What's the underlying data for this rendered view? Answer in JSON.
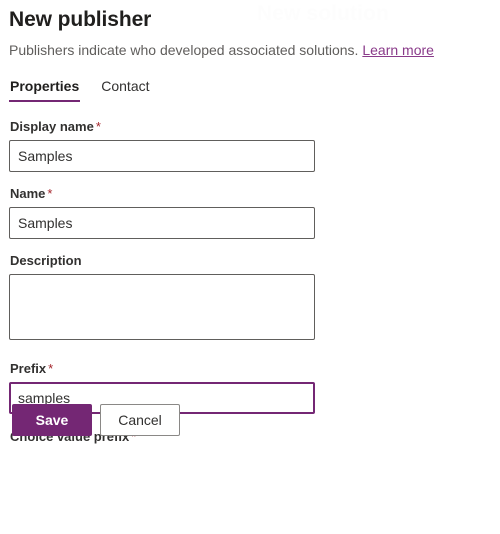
{
  "ghost": {
    "background_title": "New solution"
  },
  "header": {
    "title": "New publisher",
    "subtitle_text": "Publishers indicate who developed associated solutions.",
    "learn_more_label": "Learn more"
  },
  "tabs": [
    {
      "label": "Properties",
      "active": true
    },
    {
      "label": "Contact",
      "active": false
    }
  ],
  "form": {
    "fields": [
      {
        "label": "Display name",
        "required_marker": "*",
        "value": "Samples",
        "placeholder": "",
        "type": "text"
      },
      {
        "label": "Name",
        "required_marker": "*",
        "value": "Samples",
        "placeholder": "",
        "type": "text"
      },
      {
        "label": "Description",
        "required_marker": "",
        "value": "",
        "placeholder": "",
        "type": "textarea"
      },
      {
        "label": "Prefix",
        "required_marker": "*",
        "value": "samples",
        "placeholder": "",
        "type": "text",
        "focused": true
      },
      {
        "label": "Choice value prefix",
        "required_marker": "*",
        "value": "",
        "placeholder": "",
        "type": "text"
      }
    ]
  },
  "footer": {
    "save_label": "Save",
    "cancel_label": "Cancel"
  },
  "colors": {
    "accent": "#742774",
    "required": "#a4262c",
    "link": "#8a3b8a",
    "title": "#201f1e",
    "subtitle": "#605e5c",
    "border": "#605e5c"
  }
}
